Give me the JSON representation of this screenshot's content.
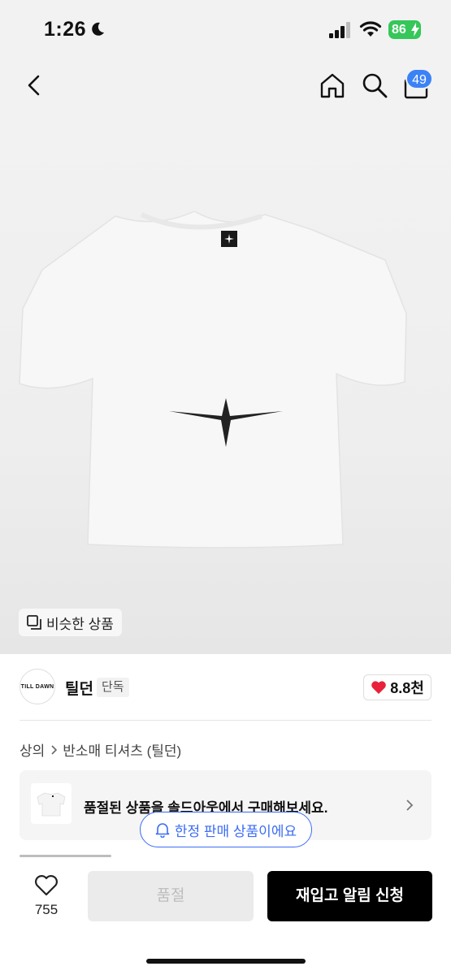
{
  "status": {
    "time": "1:26",
    "battery": "86"
  },
  "nav": {
    "cart_count": "49"
  },
  "product": {
    "similar_label": "비슷한 상품",
    "brand_logo_text": "TILL DAWN",
    "brand_name": "틸던",
    "exclusive_tag": "단독",
    "likes": "8.8천"
  },
  "breadcrumb": {
    "first": "상의",
    "second": "반소매 티셔츠 (틸던)"
  },
  "soldout_card": {
    "text": "품절된 상품을 솔드아웃에서 구매해보세요."
  },
  "limited_notice": "한정 판매 상품이에요",
  "bottom": {
    "wish_count": "755",
    "soldout_label": "품절",
    "restock_label": "재입고 알림 신청"
  },
  "colors": {
    "accent_blue": "#3b6cf5",
    "heart_red": "#e8223a",
    "battery_green": "#35c759"
  }
}
